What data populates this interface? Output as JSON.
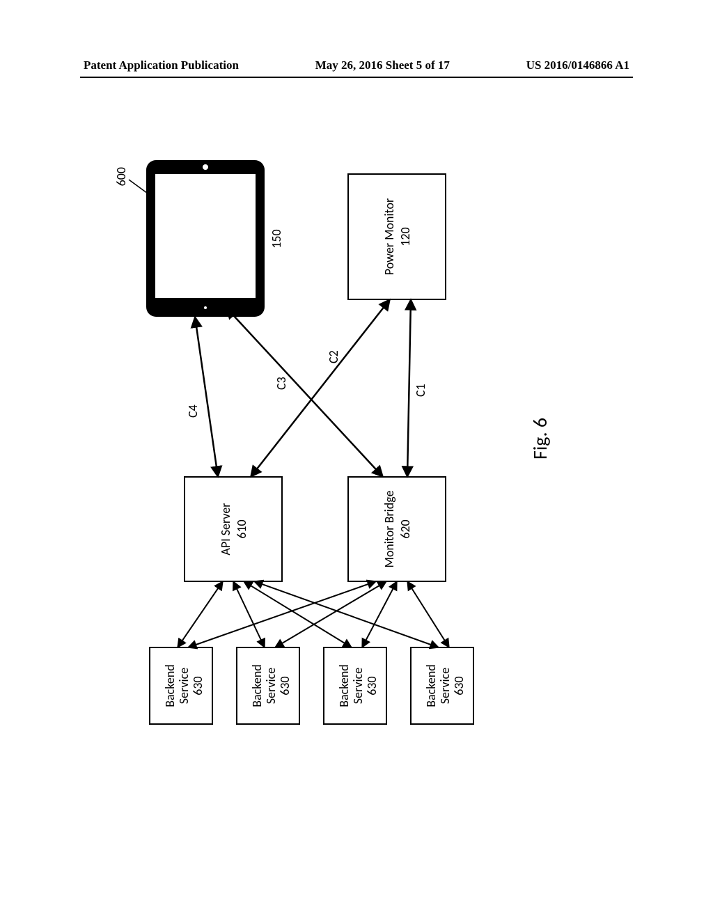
{
  "header": {
    "left": "Patent Application Publication",
    "center": "May 26, 2016  Sheet 5 of 17",
    "right": "US 2016/0146866 A1"
  },
  "figure_label": "Fig. 6",
  "system_ref": "600",
  "nodes": {
    "tablet_ref": "150",
    "power_monitor": {
      "label": "Power Monitor",
      "ref": "120"
    },
    "api_server": {
      "label": "API Server",
      "ref": "610"
    },
    "monitor_bridge": {
      "label": "Monitor Bridge",
      "ref": "620"
    },
    "backend_service_label": "Backend Service",
    "backend_service_ref": "630"
  },
  "connections": {
    "c1": "C1",
    "c2": "C2",
    "c3": "C3",
    "c4": "C4"
  },
  "chart_data": {
    "type": "diagram",
    "title": "Fig. 6",
    "system_id": "600",
    "nodes": [
      {
        "id": "150",
        "label": "Tablet/Display device"
      },
      {
        "id": "120",
        "label": "Power Monitor"
      },
      {
        "id": "610",
        "label": "API Server"
      },
      {
        "id": "620",
        "label": "Monitor Bridge"
      },
      {
        "id": "630-1",
        "label": "Backend Service"
      },
      {
        "id": "630-2",
        "label": "Backend Service"
      },
      {
        "id": "630-3",
        "label": "Backend Service"
      },
      {
        "id": "630-4",
        "label": "Backend Service"
      }
    ],
    "edges": [
      {
        "from": "620",
        "to": "120",
        "label": "C1",
        "bidirectional": true
      },
      {
        "from": "610",
        "to": "120",
        "label": "C2",
        "bidirectional": true
      },
      {
        "from": "620",
        "to": "150",
        "label": "C3",
        "bidirectional": true
      },
      {
        "from": "610",
        "to": "150",
        "label": "C4",
        "bidirectional": true
      },
      {
        "from": "630-1",
        "to": "610",
        "bidirectional": true
      },
      {
        "from": "630-2",
        "to": "610",
        "bidirectional": true
      },
      {
        "from": "630-3",
        "to": "610",
        "bidirectional": true
      },
      {
        "from": "630-4",
        "to": "610",
        "bidirectional": true
      },
      {
        "from": "630-1",
        "to": "620",
        "bidirectional": true
      },
      {
        "from": "630-2",
        "to": "620",
        "bidirectional": true
      },
      {
        "from": "630-3",
        "to": "620",
        "bidirectional": true
      },
      {
        "from": "630-4",
        "to": "620",
        "bidirectional": true
      }
    ]
  }
}
